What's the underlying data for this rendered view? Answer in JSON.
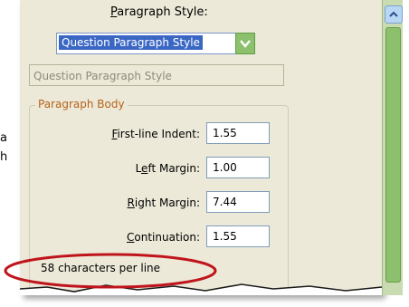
{
  "background_fragments": [
    "a",
    "h"
  ],
  "paragraph_style": {
    "label_prefix": "",
    "label_mnemonic": "P",
    "label_rest": "aragraph Style:",
    "selected": "Question Paragraph Style"
  },
  "style_name_field": "Question Paragraph Style",
  "paragraph_body": {
    "title": "Paragraph Body",
    "rows": [
      {
        "mnemonic": "F",
        "rest": "irst-line Indent:",
        "value": "1.55"
      },
      {
        "mnemonic": "",
        "pre": "L",
        "under": "e",
        "rest": "ft Margin:",
        "value": "1.00"
      },
      {
        "mnemonic": "R",
        "rest": "ight Margin:",
        "value": "7.44"
      },
      {
        "mnemonic": "C",
        "rest": "ontinuation:",
        "value": "1.55"
      }
    ],
    "chars_per_line": "58 characters per line"
  },
  "colors": {
    "panel": "#ece9d8",
    "selection": "#3b67c4",
    "group_title": "#b8621b",
    "highlight_oval": "#c0141c",
    "scrollbar": "#8cc06c"
  },
  "icons": [
    "scroll-up-arrow-icon",
    "dropdown-arrow-icon"
  ]
}
